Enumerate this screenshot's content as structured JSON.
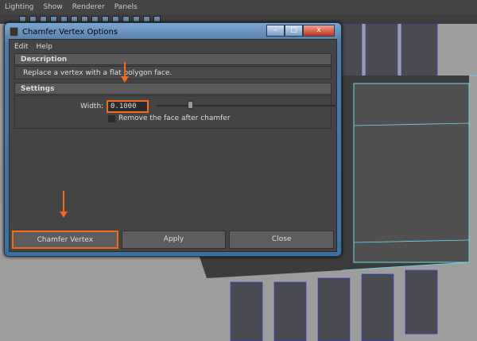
{
  "app_menu": [
    "Lighting",
    "Show",
    "Renderer",
    "Panels"
  ],
  "dialog": {
    "title": "Chamfer Vertex Options",
    "menu": [
      "Edit",
      "Help"
    ],
    "description_header": "Description",
    "description": "Replace a vertex with a flat polygon face.",
    "settings_header": "Settings",
    "width_label": "Width:",
    "width_value": "0.1000",
    "width_slider_fraction": 0.19,
    "checkbox_label": "Remove the face after chamfer",
    "checkbox_checked": false,
    "buttons": {
      "chamfer": "Chamfer Vertex",
      "apply": "Apply",
      "close": "Close"
    },
    "window_buttons": {
      "minimize": "–",
      "maximize": "□",
      "close": "x"
    }
  },
  "colors": {
    "highlight": "#f26b1d",
    "viewport": "#9d9d9d",
    "wire": "#6fd8e8"
  }
}
